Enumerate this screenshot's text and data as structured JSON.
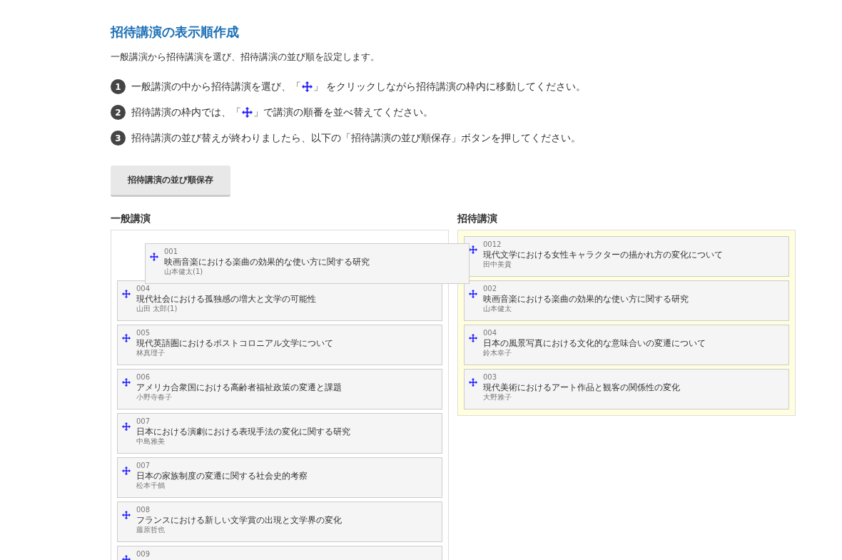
{
  "title": "招待講演の表示順作成",
  "description": "一般講演から招待講演を選び、招待講演の並び順を設定します。",
  "steps": [
    {
      "number": "1",
      "parts": [
        {
          "kind": "text",
          "text": "一般講演の中から招待講演を選び、「"
        },
        {
          "kind": "icon"
        },
        {
          "kind": "text",
          "text": "」 をクリックしながら招待講演の枠内に移動してください。"
        }
      ]
    },
    {
      "number": "2",
      "parts": [
        {
          "kind": "text",
          "text": "招待講演の枠内では、「"
        },
        {
          "kind": "icon"
        },
        {
          "kind": "text",
          "text": "」で講演の順番を並べ替えてください。"
        }
      ]
    },
    {
      "number": "3",
      "parts": [
        {
          "kind": "text",
          "text": "招待講演の並び替えが終わりましたら、以下の「招待講演の並び順保存」ボタンを押してください。"
        }
      ]
    }
  ],
  "save_button": "招待講演の並び順保存",
  "general": {
    "heading": "一般講演",
    "dragging": {
      "number": "001",
      "title": "映画音楽における楽曲の効果的な使い方に関する研究",
      "author": "山本健太(1)"
    },
    "items": [
      {
        "number": "004",
        "title": "現代社会における孤独感の増大と文学の可能性",
        "author": "山田 太郎(1)"
      },
      {
        "number": "005",
        "title": "現代英語圏におけるポストコロニアル文学について",
        "author": "林真理子"
      },
      {
        "number": "006",
        "title": "アメリカ合衆国における高齢者福祉政策の変遷と課題",
        "author": "小野寺春子"
      },
      {
        "number": "007",
        "title": "日本における演劇における表現手法の変化に関する研究",
        "author": "中島雅美"
      },
      {
        "number": "007",
        "title": "日本の家族制度の変遷に関する社会史的考察",
        "author": "松本千鶴"
      },
      {
        "number": "008",
        "title": "フランスにおける新しい文学賞の出現と文学界の変化",
        "author": "藤原哲也"
      },
      {
        "number": "009"
      }
    ]
  },
  "invited": {
    "heading": "招待講演",
    "items": [
      {
        "number": "0012",
        "title": "現代文学における女性キャラクターの描かれ方の変化について",
        "author": "田中美貴"
      },
      {
        "number": "002",
        "title": "映画音楽における楽曲の効果的な使い方に関する研究",
        "author": "山本健太"
      },
      {
        "number": "004",
        "title": "日本の風景写真における文化的な意味合いの変遷について",
        "author": "鈴木幸子"
      },
      {
        "number": "003",
        "title": "現代美術におけるアート作品と観客の関係性の変化",
        "author": "大野雅子"
      }
    ]
  }
}
